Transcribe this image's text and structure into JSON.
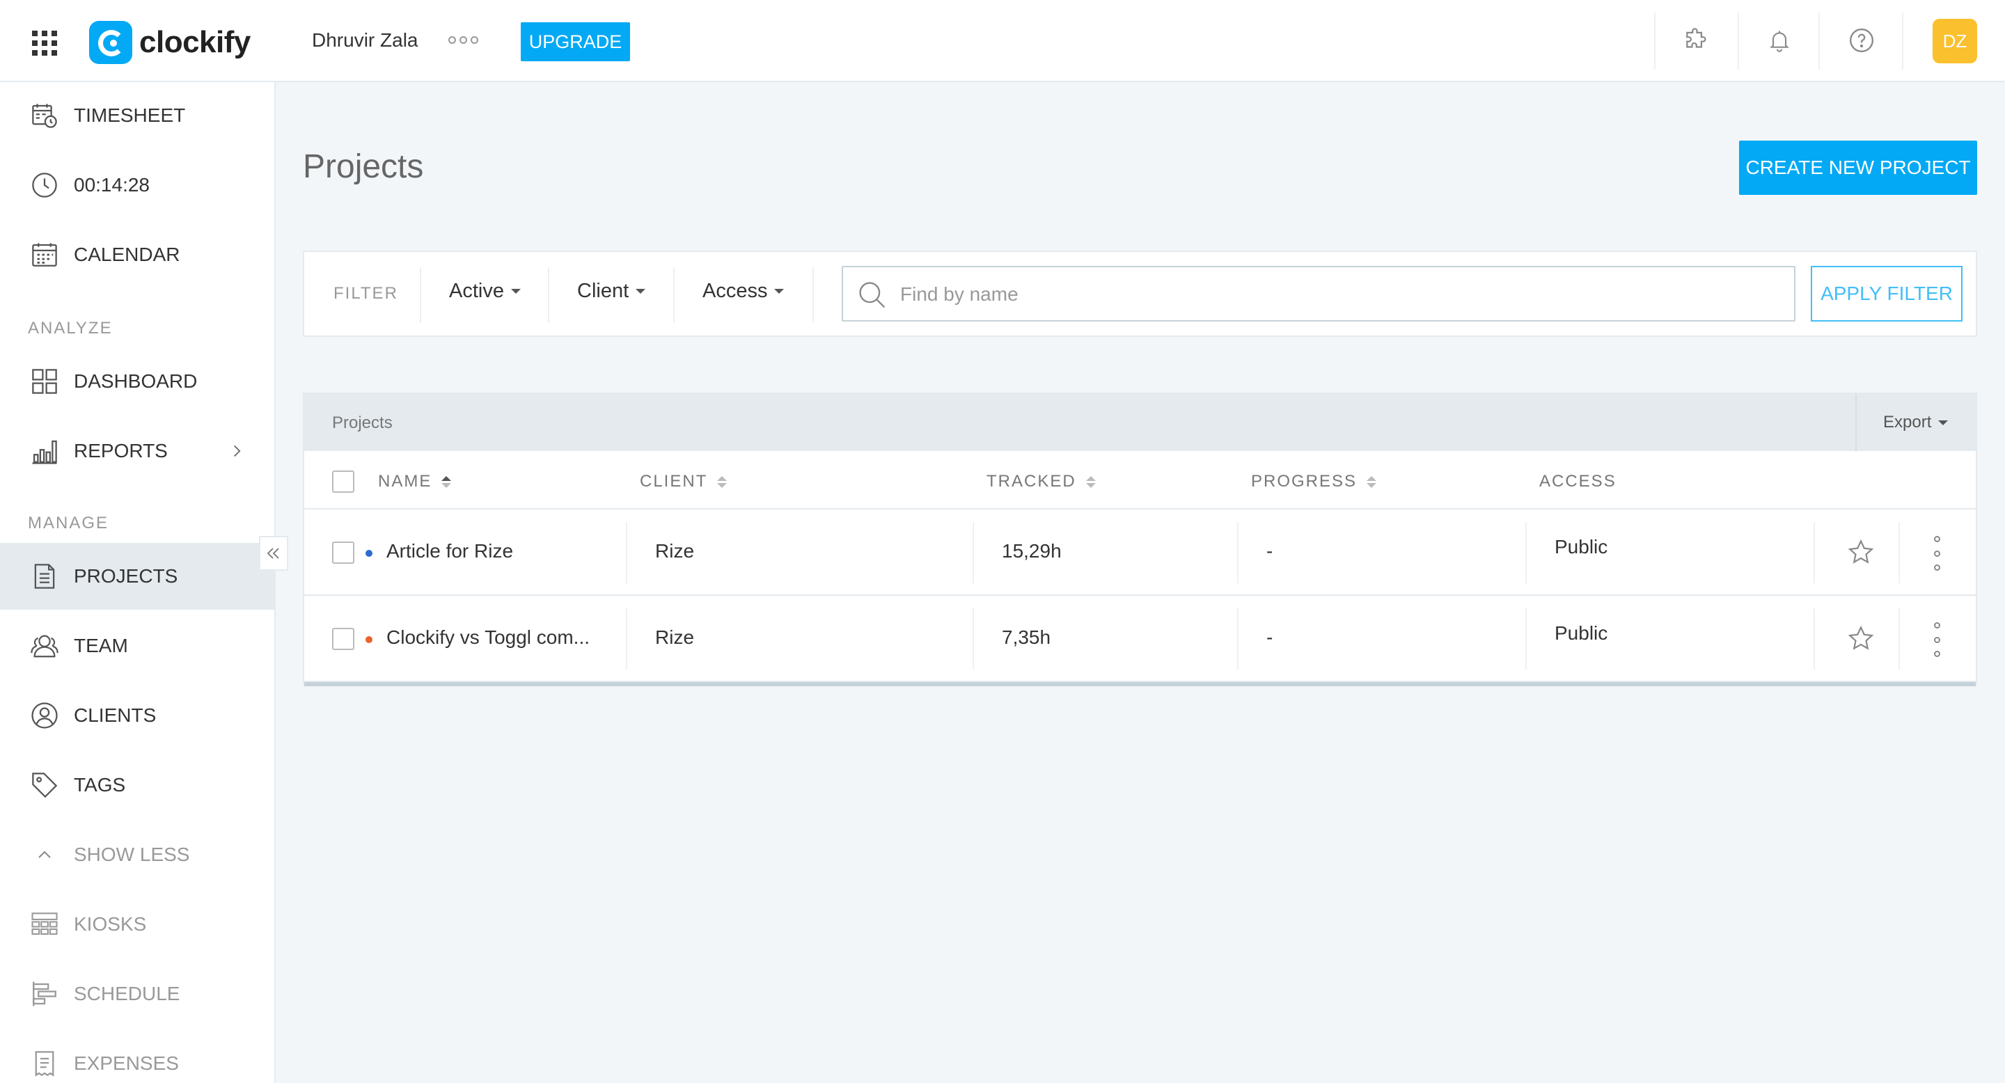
{
  "topbar": {
    "logo_text": "clockify",
    "workspace": "Dhruvir Zala",
    "upgrade_label": "UPGRADE",
    "avatar_initials": "DZ",
    "icons": [
      "apps-grid-icon",
      "extension-puzzle-icon",
      "bell-icon",
      "help-icon"
    ]
  },
  "sidebar": {
    "items": [
      {
        "label": "TIMESHEET",
        "icon": "timesheet-icon"
      },
      {
        "label": "00:14:28",
        "icon": "clock-icon"
      },
      {
        "label": "CALENDAR",
        "icon": "calendar-icon"
      }
    ],
    "analyze_label": "ANALYZE",
    "analyze_items": [
      {
        "label": "DASHBOARD",
        "icon": "dashboard-icon"
      },
      {
        "label": "REPORTS",
        "icon": "reports-icon"
      }
    ],
    "manage_label": "MANAGE",
    "manage_items": [
      {
        "label": "PROJECTS",
        "icon": "projects-icon",
        "active": true
      },
      {
        "label": "TEAM",
        "icon": "team-icon"
      },
      {
        "label": "CLIENTS",
        "icon": "clients-icon"
      },
      {
        "label": "TAGS",
        "icon": "tag-icon"
      }
    ],
    "show_less_label": "SHOW LESS",
    "extra_items": [
      {
        "label": "KIOSKS",
        "icon": "kiosk-icon"
      },
      {
        "label": "SCHEDULE",
        "icon": "schedule-icon"
      },
      {
        "label": "EXPENSES",
        "icon": "expenses-icon"
      }
    ]
  },
  "main": {
    "title": "Projects",
    "create_label": "CREATE NEW PROJECT",
    "filter": {
      "label": "FILTER",
      "status": "Active",
      "client": "Client",
      "access": "Access",
      "search_placeholder": "Find by name",
      "apply_label": "APPLY FILTER"
    },
    "table": {
      "caption": "Projects",
      "export_label": "Export",
      "columns": [
        "NAME",
        "CLIENT",
        "TRACKED",
        "PROGRESS",
        "ACCESS"
      ],
      "rows": [
        {
          "name": "Article for Rize",
          "dot_color": "#2c6ccf",
          "client": "Rize",
          "tracked": "15,29h",
          "progress": "-",
          "access": "Public"
        },
        {
          "name": "Clockify vs Toggl com...",
          "dot_color": "#e8632c",
          "client": "Rize",
          "tracked": "7,35h",
          "progress": "-",
          "access": "Public"
        }
      ]
    }
  },
  "colors": {
    "accent": "#03a9f4",
    "avatar": "#fbc02d",
    "sidebar_active": "#e4eaee",
    "background": "#f2f6f8"
  }
}
